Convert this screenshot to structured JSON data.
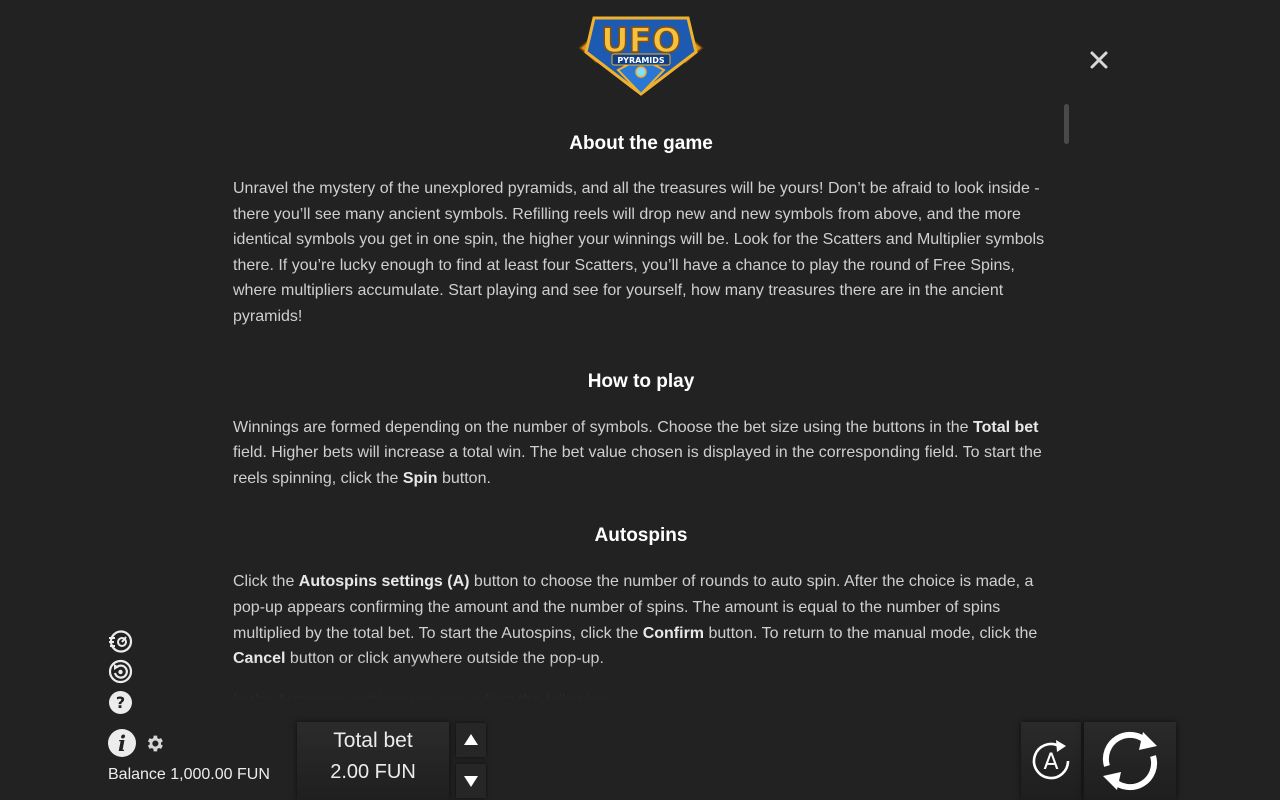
{
  "logo": {
    "title": "UFO",
    "subtitle": "PYRAMIDS"
  },
  "sections": {
    "about": {
      "title": "About the game",
      "text": "Unravel the mystery of the unexplored pyramids, and all the treasures will be yours! Don’t be afraid to look inside - there you’ll see many ancient symbols. Refilling reels will drop new and new symbols from above, and the more identical symbols you get in one spin, the higher your winnings will be. Look for the Scatters and Multiplier symbols there. If you’re lucky enough to find at least four Scatters, you’ll have a chance to play the round of Free Spins, where multipliers accumulate. Start playing and see for yourself, how many treasures there are in the ancient pyramids!"
    },
    "how_to_play": {
      "title": "How to play",
      "t1": "Winnings are formed depending on the number of symbols. Choose the bet size using the buttons in the ",
      "b1": "Total bet",
      "t2": " field. Higher bets will increase a total win. The bet value chosen is displayed in the corresponding field. To start the reels spinning, click the ",
      "b2": "Spin",
      "t3": " button."
    },
    "autospins": {
      "title": "Autospins",
      "t1": "Click the ",
      "b1": "Autospins settings (A)",
      "t2": " button to choose the number of rounds to auto spin. After the choice is made, a pop-up appears confirming the amount and the number of spins. The amount is equal to the number of spins multiplied by the total bet. To start the Autospins, click the ",
      "b2": "Confirm",
      "t3": " button. To return to the manual mode, click the ",
      "b3": "Cancel",
      "t4": " button or click anywhere outside the pop-up.",
      "adjust": "In the Autospins settings you can adjust the following:"
    }
  },
  "footer": {
    "balance": "Balance 1,000.00 FUN",
    "total_bet_label": "Total bet",
    "total_bet_value": "2.00 FUN",
    "auto_letter": "A"
  },
  "icons": {
    "close": "close-icon",
    "turbo": "turbo-icon",
    "quick_spin": "quick-spin-icon",
    "help": "help-icon",
    "info": "info-icon",
    "settings": "gear-icon",
    "bet_up": "arrow-up-icon",
    "bet_down": "arrow-down-icon",
    "autospin": "autospin-icon",
    "spin": "spin-icon"
  },
  "colors": {
    "background": "#222222",
    "text": "#cfcfcf",
    "heading": "#ffffff",
    "logo_gold": "#e8a623",
    "logo_blue": "#1f5fb8"
  }
}
